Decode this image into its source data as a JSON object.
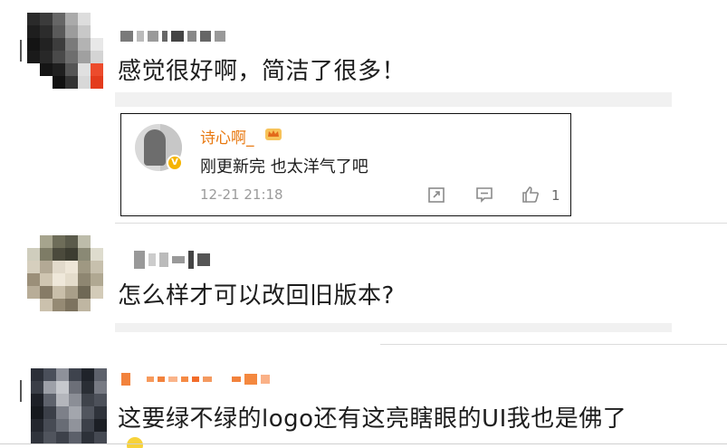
{
  "comments": [
    {
      "text": "感觉很好啊，简洁了很多！"
    },
    {
      "text": "怎么样才可以改回旧版本?"
    },
    {
      "text": "这要绿不绿的logo还有这亮瞎眼的UI我也是佛了"
    }
  ],
  "reply": {
    "username": "诗心啊_",
    "text": "刚更新完 也太洋气了吧",
    "timestamp": "12-21 21:18",
    "like_count": "1",
    "icons": {
      "share": "share-icon",
      "comment": "comment-icon",
      "like": "thumbs-up-icon",
      "verified": "verified-badge-icon",
      "crown": "crown-icon"
    }
  },
  "colors": {
    "username_accent": "#e8780f",
    "meta_gray": "#9b9b9b",
    "verify_gold": "#f5b400"
  }
}
